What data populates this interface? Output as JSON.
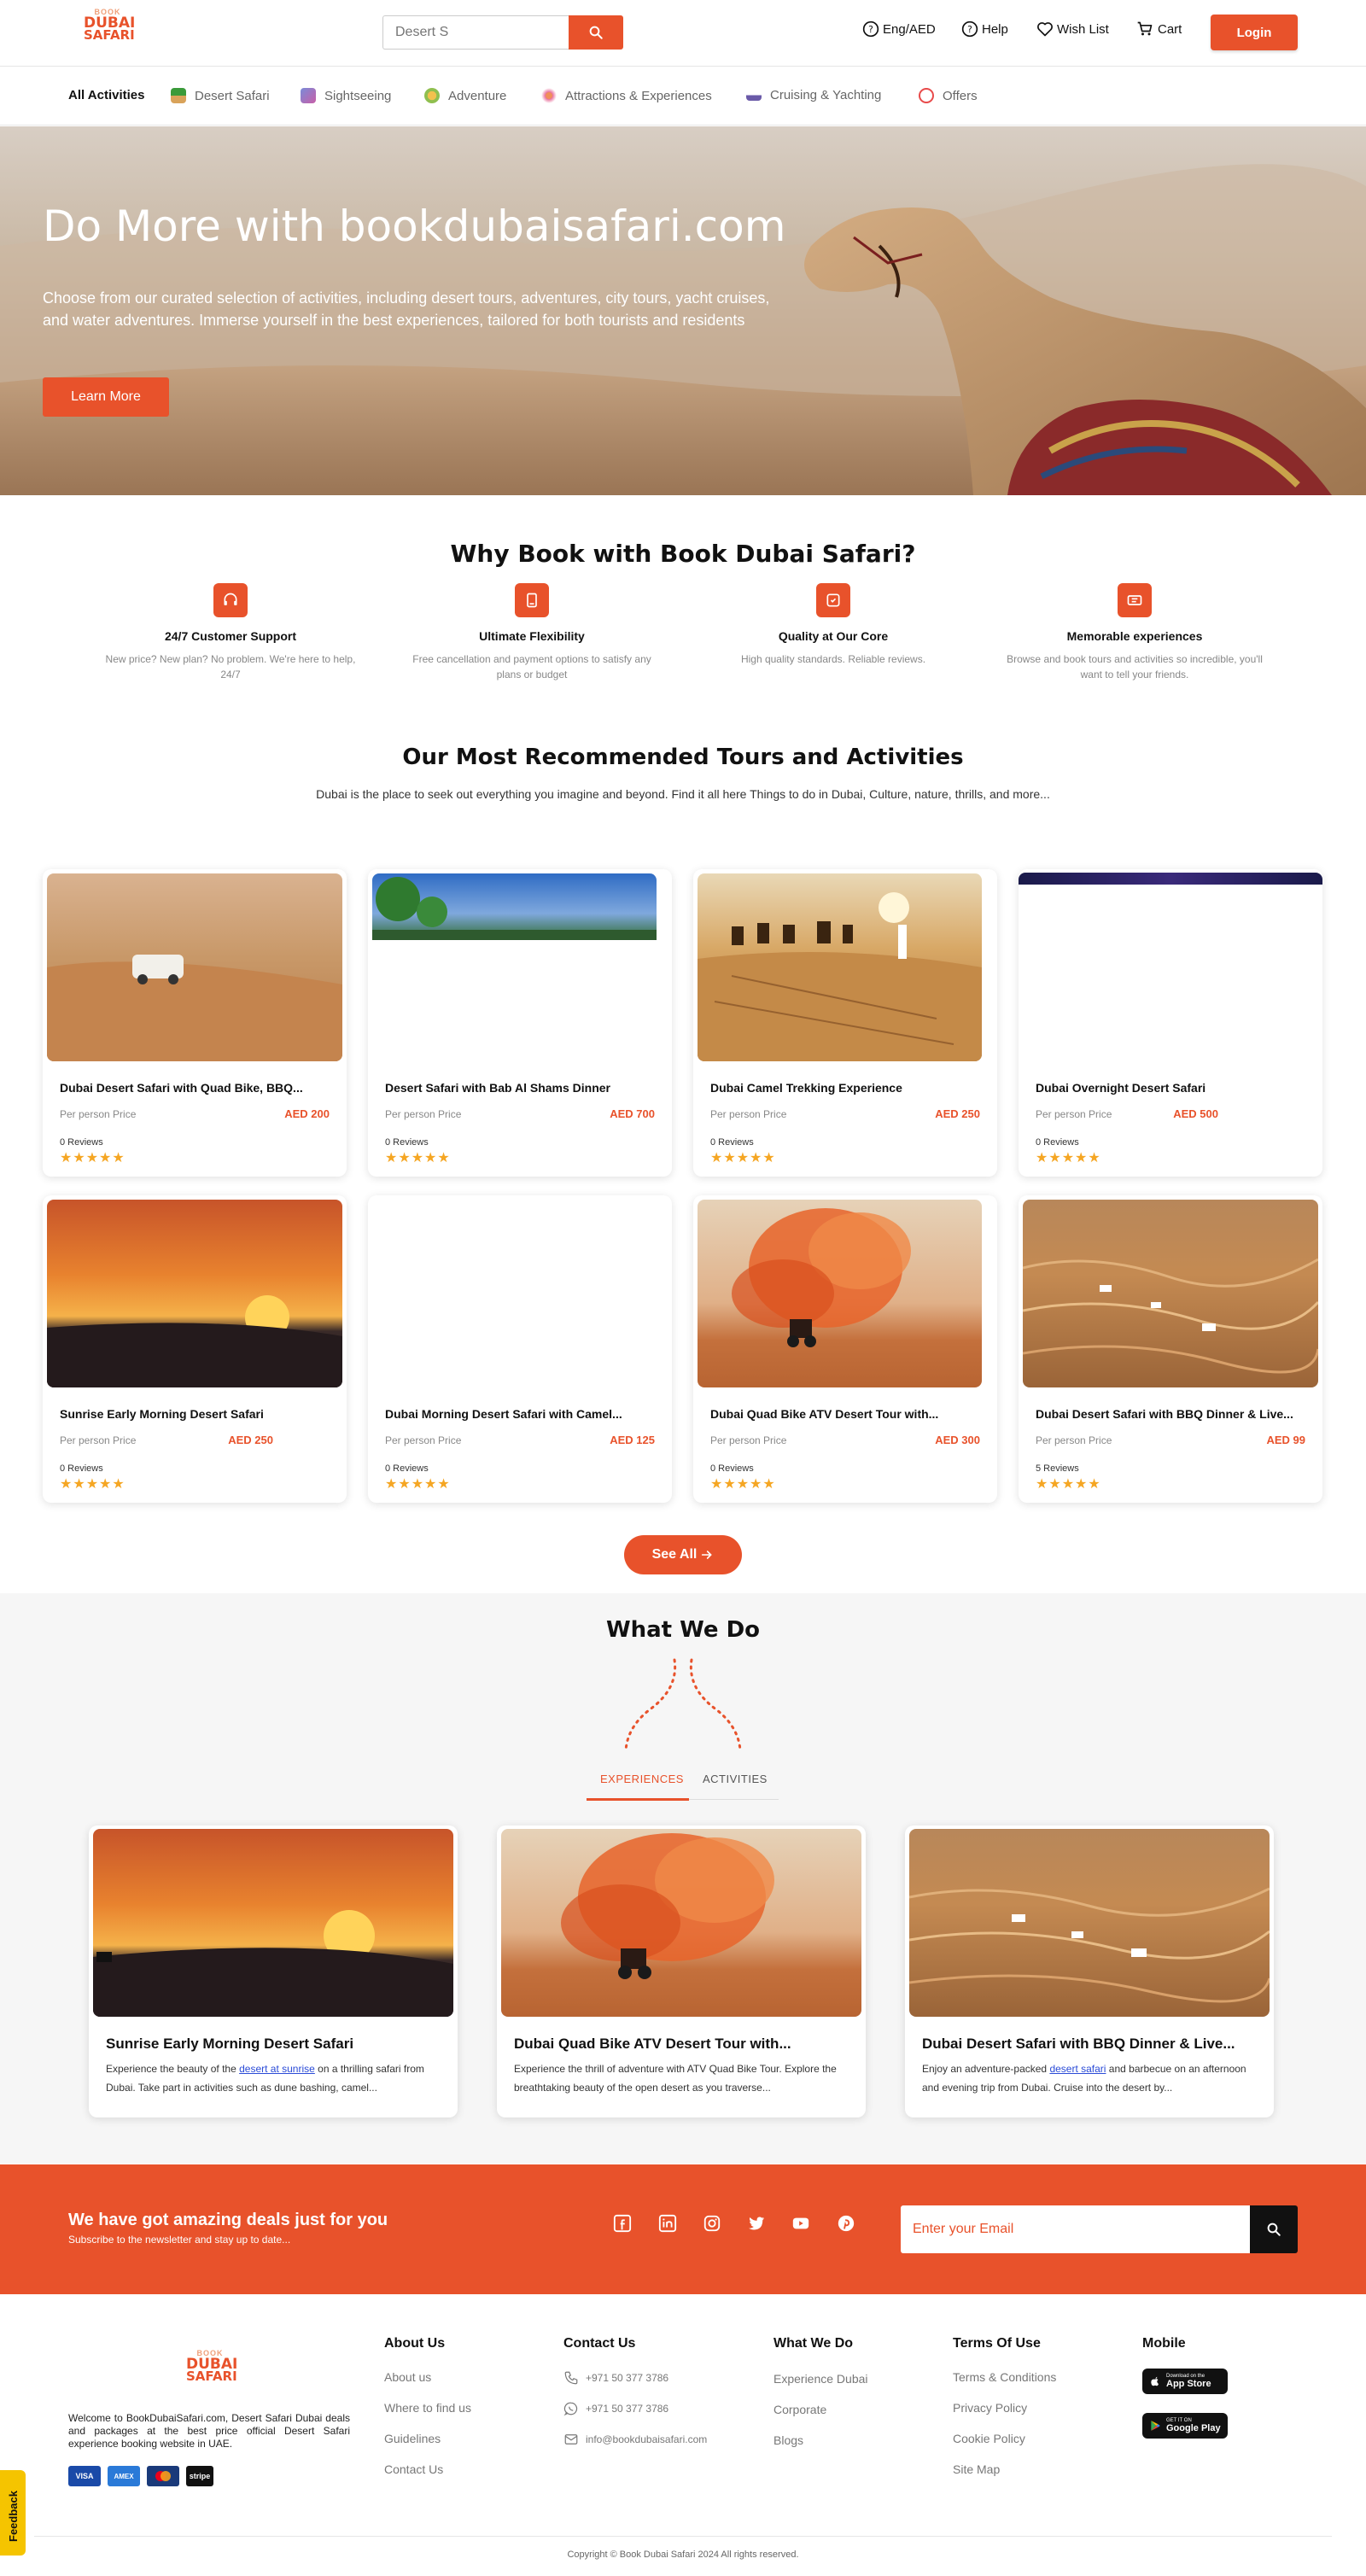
{
  "header": {
    "logo": {
      "l1": "BOOK",
      "l2": "DUBAI",
      "l3": "SAFARI"
    },
    "search_placeholder": "Desert S",
    "lang": "Eng/AED",
    "help": "Help",
    "wishlist": "Wish List",
    "cart": "Cart",
    "login": "Login"
  },
  "categories": [
    "All Activities",
    "Desert Safari",
    "Sightseeing",
    "Adventure",
    "Attractions & Experiences",
    "Cruising & Yachting",
    "Offers"
  ],
  "hero": {
    "title": "Do More with bookdubaisafari.com",
    "desc": "Choose from our curated selection of activities, including desert tours, adventures, city tours, yacht cruises, and water adventures. Immerse yourself in the best experiences, tailored for both tourists and residents",
    "button": "Learn More"
  },
  "why": {
    "title": "Why Book with Book Dubai Safari?",
    "features": [
      {
        "title": "24/7 Customer Support",
        "desc": "New price? New plan? No problem. We're here to help, 24/7"
      },
      {
        "title": "Ultimate Flexibility",
        "desc": "Free cancellation and payment options to satisfy any plans or budget"
      },
      {
        "title": "Quality at Our Core",
        "desc": "High quality standards. Reliable reviews."
      },
      {
        "title": "Memorable experiences",
        "desc": "Browse and book tours and activities so incredible, you'll want to tell your friends."
      }
    ]
  },
  "recommended": {
    "title": "Our Most Recommended Tours and Activities",
    "subtitle": "Dubai is the place to seek out everything you imagine and beyond. Find it all here Things to do in Dubai, Culture, nature, thrills, and more...",
    "per_person": "Per person Price",
    "stars": "★★★★★",
    "cards": [
      {
        "title": "Dubai Desert Safari with Quad Bike, BBQ...",
        "price": "AED 200",
        "reviews": "0 Reviews"
      },
      {
        "title": "Desert Safari with Bab Al Shams Dinner",
        "price": "AED 700",
        "reviews": "0 Reviews"
      },
      {
        "title": "Dubai Camel Trekking Experience",
        "price": "AED 250",
        "reviews": "0 Reviews"
      },
      {
        "title": "Dubai Overnight Desert Safari",
        "price": "AED 500",
        "reviews": "0 Reviews"
      },
      {
        "title": "Sunrise Early Morning Desert Safari",
        "price": "AED 250",
        "reviews": "0 Reviews"
      },
      {
        "title": "Dubai Morning Desert Safari with Camel...",
        "price": "AED 125",
        "reviews": "0 Reviews"
      },
      {
        "title": "Dubai Quad Bike ATV Desert Tour with...",
        "price": "AED 300",
        "reviews": "0 Reviews"
      },
      {
        "title": "Dubai Desert Safari with BBQ Dinner & Live...",
        "price": "AED 99",
        "reviews": "5 Reviews"
      }
    ],
    "see_all": "See All"
  },
  "what_we_do": {
    "title": "What We Do",
    "tabs": [
      "EXPERIENCES",
      "ACTIVITIES"
    ],
    "cards": [
      {
        "title": "Sunrise Early Morning Desert Safari",
        "pre": "Experience the beauty of the ",
        "link": "desert at sunrise",
        "post": " on a thrilling safari from Dubai. Take part in activities such as dune bashing, camel..."
      },
      {
        "title": "Dubai Quad Bike ATV Desert Tour with...",
        "pre": "Experience the thrill of adventure with ATV Quad Bike Tour. Explore the breathtaking beauty of the open desert as you traverse...",
        "link": "",
        "post": ""
      },
      {
        "title": "Dubai Desert Safari with BBQ Dinner & Live...",
        "pre": "Enjoy an adventure-packed ",
        "link": "desert safari",
        "post": " and barbecue on an afternoon and evening trip from Dubai. Cruise into the desert by..."
      }
    ]
  },
  "newsletter": {
    "title": "We have got amazing deals just for you",
    "subtitle": "Subscribe to the newsletter and stay up to date...",
    "placeholder": "Enter your Email"
  },
  "footer": {
    "about_text": "Welcome to BookDubaiSafari.com, Desert Safari Dubai deals and packages at the best price official Desert Safari experience booking website in UAE.",
    "payments": [
      "VISA",
      "AMEX",
      "MC",
      "stripe"
    ],
    "about": {
      "title": "About Us",
      "links": [
        "About us",
        "Where to find us",
        "Guidelines",
        "Contact Us"
      ]
    },
    "contact": {
      "title": "Contact Us",
      "links": [
        "+971 50 377 3786",
        "+971 50 377 3786",
        "info@bookdubaisafari.com"
      ]
    },
    "whatwedo": {
      "title": "What We Do",
      "links": [
        "Experience Dubai",
        "Corporate",
        "Blogs"
      ]
    },
    "terms": {
      "title": "Terms Of Use",
      "links": [
        "Terms & Conditions",
        "Privacy Policy",
        "Cookie Policy",
        "Site Map"
      ]
    },
    "mobile": {
      "title": "Mobile",
      "app_store_small": "Download on the",
      "app_store": "App Store",
      "google_small": "GET IT ON",
      "google": "Google Play"
    },
    "copyright": "Copyright © Book Dubai Safari 2024 All rights reserved."
  },
  "feedback": "Feedback",
  "colors": {
    "accent": "#e8522b",
    "star": "#f5a623"
  }
}
